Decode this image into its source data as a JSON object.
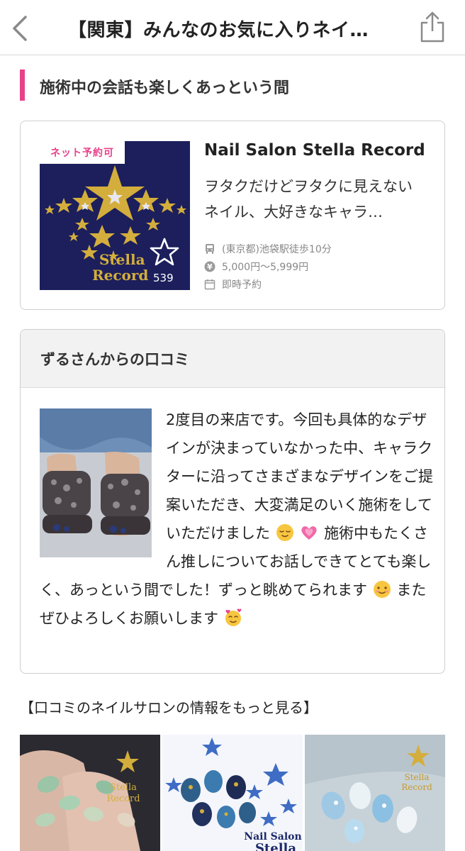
{
  "header": {
    "title": "【関東】みんなのお気に入りネイ…",
    "back_icon": "chevron-left-icon",
    "share_icon": "share-icon"
  },
  "section": {
    "heading": "施術中の会話も楽しくあっという間",
    "accent_color": "#e8418a"
  },
  "salon": {
    "badge": "ネット予約可",
    "logo_line1": "Stella",
    "logo_line2": "Record",
    "favorite_count": "539",
    "name": "Nail Salon Stella Record",
    "description": "ヲタクだけどヲタクに見えないネイル、大好きなキャラ…",
    "access": "(東京都)池袋駅徒歩10分",
    "price": "5,000円〜5,999円",
    "booking": "即時予約"
  },
  "review": {
    "heading": "ずるさんからの口コミ",
    "text_part1": "2度目の来店です。今回も具体的なデザインが決まっていなかった中、キャラクターに沿ってさまざまなデザインをご提案いただき、大変満足のいく施術をしていただけました",
    "text_part2": "施術中もたくさん推しについてお話しできてとても楽しく、あっという間でした！ずっと眺めてられます",
    "text_part3": "またぜひよろしくお願いします"
  },
  "more": {
    "link": "【口コミのネイルサロンの情報をもっと見る】",
    "thumb2_caption_1": "Nail Salon",
    "thumb2_caption_2": "Stella",
    "thumb1_logo_1": "Stella",
    "thumb1_logo_2": "Record",
    "thumb3_logo_1": "Stella",
    "thumb3_logo_2": "Record"
  },
  "colors": {
    "accent": "#e8418a",
    "navy": "#1c1f5c",
    "gold": "#d4ae3c"
  }
}
